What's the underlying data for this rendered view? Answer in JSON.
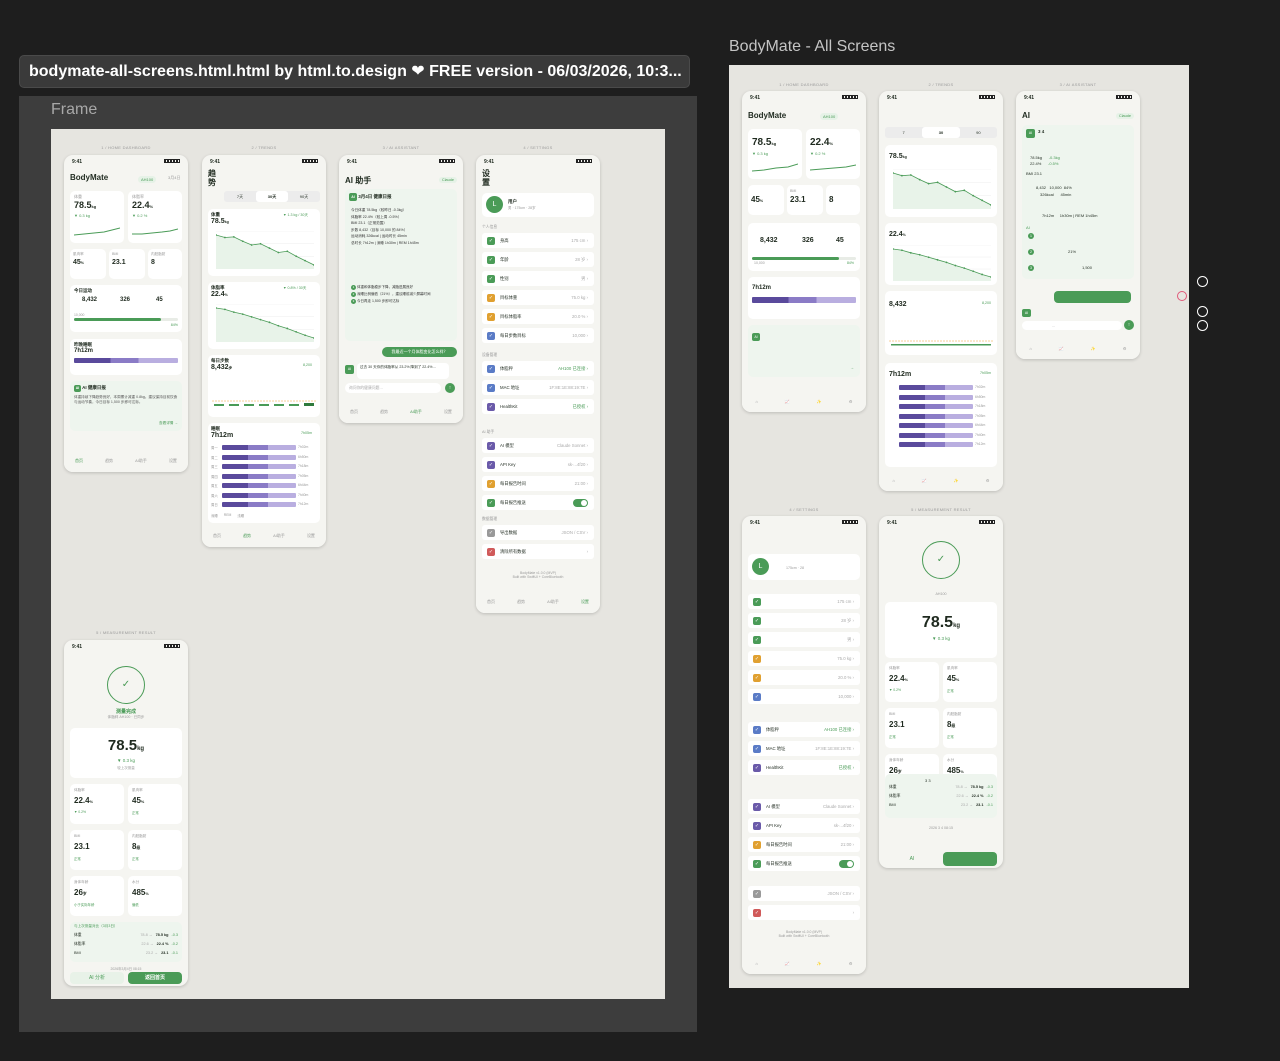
{
  "tooltip": {
    "text": "bodymate-all-screens.html.html by html.to.design ❤ FREE version - 06/03/2026, 10:3..."
  },
  "frame": {
    "label": "Frame"
  },
  "artboard": {
    "label": "BodyMate - All Screens"
  },
  "colors": {
    "accent": "#4a9b57",
    "sleep_deep": "#5a4a9c",
    "sleep_rem": "#8a7bc6",
    "sleep_light": "#b9aee0",
    "canvas": "#1e1e1e"
  },
  "screens": {
    "home_label": "1 / HOME DASHBOARD",
    "trends_label": "2 / TRENDS",
    "ai_label": "3 / AI ASSISTANT",
    "settings_label": "4 / SETTINGS",
    "measure_label": "5 / MEASUREMENT RESULT"
  },
  "status": {
    "time": "9:41"
  },
  "home": {
    "title": "BodyMate",
    "badge": "AH100",
    "date": "3月4日",
    "weight_label": "体重",
    "weight": "78.5",
    "weight_unit": "kg",
    "weight_delta": "▼ 0.3 kg",
    "fat_label": "体脂率",
    "fat": "22.4",
    "fat_unit": "%",
    "fat_delta": "▼ 0.2 %",
    "muscle_label": "肌肉率",
    "muscle": "45",
    "muscle_unit": "%",
    "bmi_label": "BMI",
    "bmi": "23.1",
    "visceral_label": "内脏脂肪",
    "visceral": "8",
    "activity_title": "今日运动",
    "steps": "8,432",
    "kcal": "326",
    "minutes": "45",
    "steps_goal": "10,000",
    "activity_pct": "84%",
    "sleep_title": "昨晚睡眠",
    "sleep_time": "7h12m",
    "ai_title": "AI 健康日报",
    "ai_text": "体重持续下降趋势良好，本周累计减重 0.8kg。建议保持目前饮食与运动节奏，今日目标 1,500 步即可达标。",
    "ai_link": "查看详情 →",
    "tabs": [
      "首页",
      "趋势",
      "AI助手",
      "设置"
    ]
  },
  "trends": {
    "title": "趋势",
    "range": [
      "7天",
      "30天",
      "90天"
    ],
    "weight_title": "体重",
    "weight": "78.5",
    "weight_unit": "kg",
    "weight_delta": "▼ 1.3 kg / 30天",
    "fat_title": "体脂率",
    "fat": "22.4",
    "fat_unit": "%",
    "fat_delta": "▼ 0.8% / 30天",
    "steps_title": "每日步数",
    "steps": "8,432",
    "steps_unit": "步",
    "steps_avg": "8,200",
    "sleep_title": "睡眠",
    "sleep": "7h12m",
    "sleep_avg": "7h05m",
    "sleep_rows": [
      {
        "day": "周一",
        "dur": "7h02m"
      },
      {
        "day": "周二",
        "dur": "6h50m"
      },
      {
        "day": "周三",
        "dur": "7h18m"
      },
      {
        "day": "周四",
        "dur": "7h05m"
      },
      {
        "day": "周五",
        "dur": "6h44m"
      },
      {
        "day": "周六",
        "dur": "7h40m"
      },
      {
        "day": "周日",
        "dur": "7h12m"
      }
    ],
    "legend": [
      "深睡",
      "REM",
      "浅睡"
    ]
  },
  "ai": {
    "title": "AI 助手",
    "model_badge": "Claude",
    "report_title": "3月4日 健康日报",
    "lines": [
      "今日体重 78.5kg（较昨日 -0.3kg）",
      "体脂率 22.4%（较上周 -0.5%）",
      "BMI 23.1（正常范围）",
      "步数 8,432（目标 10,000 的 84%）",
      "运动消耗 326kcal | 运动时长 45min",
      "总时长 7h12m | 深睡 1h30m | REM 1h45m"
    ],
    "tips": [
      "体重和体脂稳步下降，减脂进展良好",
      "深睡比例偏低（21%），建议睡前减少屏幕时间",
      "今日再走 1,500 步即可达标"
    ],
    "user_msg": "我最近一个月体脂变化怎么样？",
    "bot_msg": "过去 30 天你的体脂率从 23.2% 降到了 22.4%…",
    "input_placeholder": "询问你的健康问题…",
    "send_icon": "↑"
  },
  "settings": {
    "title": "设置",
    "user_name": "用户",
    "user_meta": "男 · 175cm · 28岁",
    "group1": "个人信息",
    "personal": [
      {
        "label": "身高",
        "value": "175 cm"
      },
      {
        "label": "年龄",
        "value": "28 岁"
      },
      {
        "label": "性别",
        "value": "男"
      },
      {
        "label": "目标体重",
        "value": "75.0 kg"
      },
      {
        "label": "目标体脂率",
        "value": "20.0 %"
      },
      {
        "label": "每日步数目标",
        "value": "10,000"
      }
    ],
    "group2": "设备管理",
    "device": [
      {
        "label": "体脂秤",
        "value": "AH100 已连接"
      },
      {
        "label": "MAC 地址",
        "value": "1F:8E:1E:88:19:7E"
      },
      {
        "label": "HealthKit",
        "value": "已授权"
      }
    ],
    "group3": "AI 助手",
    "aiset": [
      {
        "label": "AI 模型",
        "value": "Claude Sonnet"
      },
      {
        "label": "API Key",
        "value": "sk-...4f20"
      },
      {
        "label": "每日报告时间",
        "value": "21:00"
      },
      {
        "label": "每日报告推送",
        "value": ""
      }
    ],
    "group4": "数据管理",
    "dataset": [
      {
        "label": "导出数据",
        "value": "JSON / CSV"
      },
      {
        "label": "清除所有数据",
        "value": ""
      }
    ],
    "footer": "BodyMate v1.0.0 (MVP)",
    "footer2": "Built with SwiftUI + CoreBluetooth"
  },
  "measure": {
    "title": "测量完成",
    "device": "AH100",
    "sub": "体脂秤 AH100 · 已同步",
    "weight": "78.5",
    "unit": "kg",
    "delta": "▼ 0.3 kg",
    "vs": "较上次测量",
    "metrics": [
      {
        "label": "体脂率",
        "value": "22.4",
        "unit": "%",
        "note": "▼ 0.2%"
      },
      {
        "label": "肌肉率",
        "value": "45",
        "unit": "%",
        "note": "正常"
      },
      {
        "label": "BMI",
        "value": "23.1",
        "unit": "",
        "note": "正常"
      },
      {
        "label": "内脏脂肪",
        "value": "8",
        "unit": "级",
        "note": "正常"
      },
      {
        "label": "身体年龄",
        "value": "26",
        "unit": "岁",
        "note": "小于实际年龄"
      },
      {
        "label": "水分",
        "value": "485",
        "unit": "%",
        "note": "偏低"
      }
    ],
    "compare_title": "与上次测量对比（3月3日）",
    "compare": [
      {
        "label": "体重",
        "old": "78.8",
        "new": "78.5 kg",
        "d": "-0.3"
      },
      {
        "label": "体脂率",
        "old": "22.6",
        "new": "22.4 %",
        "d": "-0.2"
      },
      {
        "label": "BMI",
        "old": "23.2",
        "new": "23.1",
        "d": "-0.1"
      }
    ],
    "time": "2026年3月4日 08:15",
    "ai_btn": "AI 分析",
    "home_btn": "返回首页"
  }
}
